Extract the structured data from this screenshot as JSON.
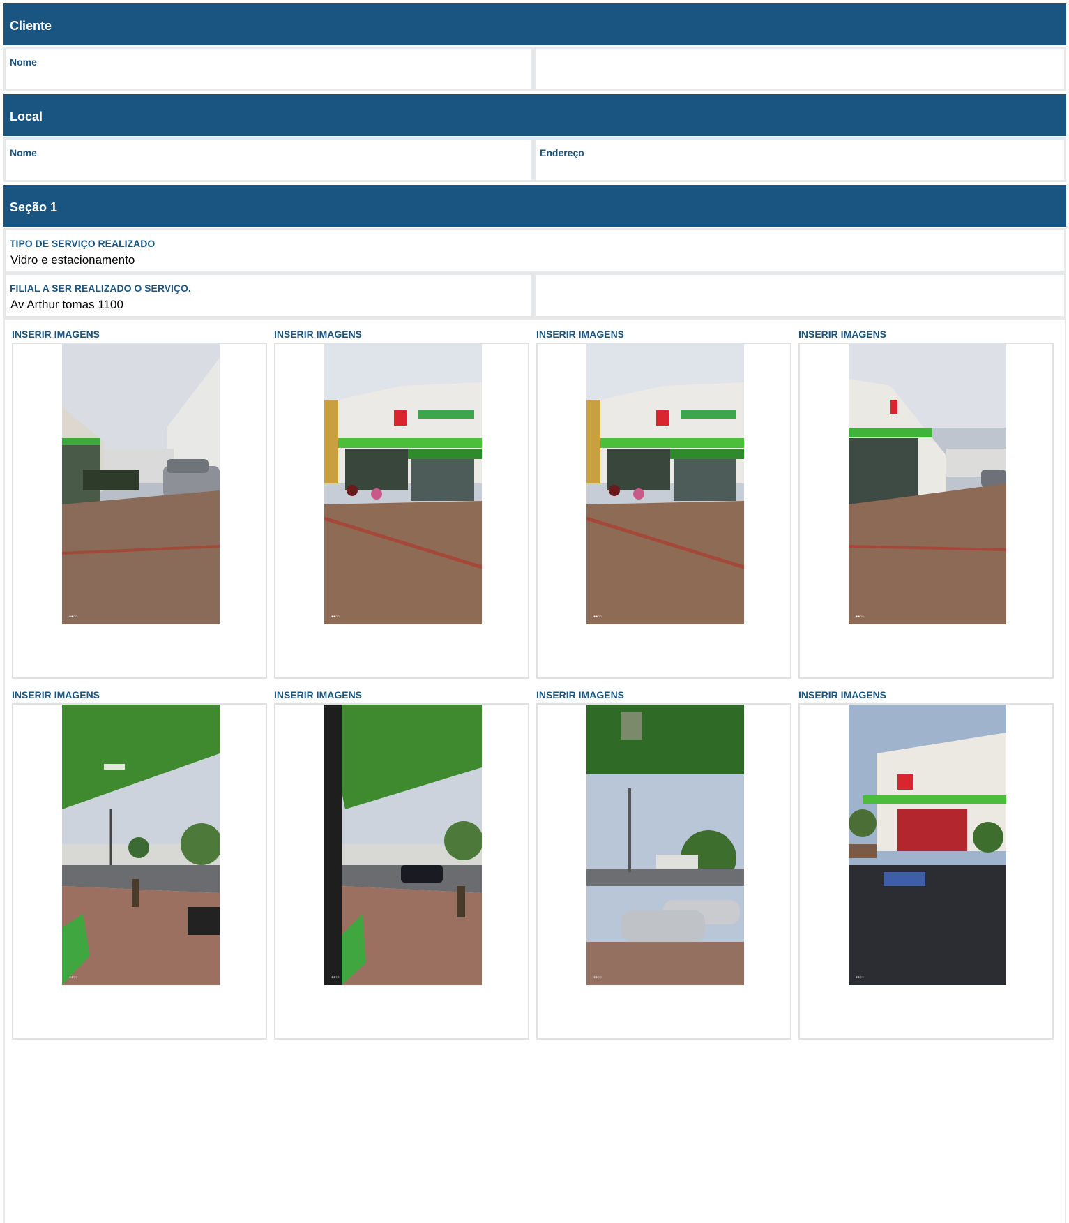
{
  "cliente": {
    "header": "Cliente",
    "nome_label": "Nome"
  },
  "local": {
    "header": "Local",
    "nome_label": "Nome",
    "endereco_label": "Endereço"
  },
  "secao1": {
    "header": "Seção 1",
    "tipo_servico_label": "TIPO DE SERVIÇO REALIZADO",
    "tipo_servico_value": "Vidro e estacionamento",
    "filial_label": "FILIAL A SER REALIZADO O SERVIÇO.",
    "filial_value": "Av Arthur tomas 1100"
  },
  "images": [
    {
      "label": "INSERIR IMAGENS",
      "scene": "building-corner-parking"
    },
    {
      "label": "INSERIR IMAGENS",
      "scene": "pharmacy-front"
    },
    {
      "label": "INSERIR IMAGENS",
      "scene": "pharmacy-front"
    },
    {
      "label": "INSERIR IMAGENS",
      "scene": "pharmacy-side"
    },
    {
      "label": "INSERIR IMAGENS",
      "scene": "street-view-awning"
    },
    {
      "label": "INSERIR IMAGENS",
      "scene": "street-view-awning-2"
    },
    {
      "label": "INSERIR IMAGENS",
      "scene": "cars-street"
    },
    {
      "label": "INSERIR IMAGENS",
      "scene": "pharmacy-parking"
    }
  ],
  "colors": {
    "header_bg": "#1a5581",
    "label": "#1a5581",
    "border": "#e6e8ea"
  }
}
